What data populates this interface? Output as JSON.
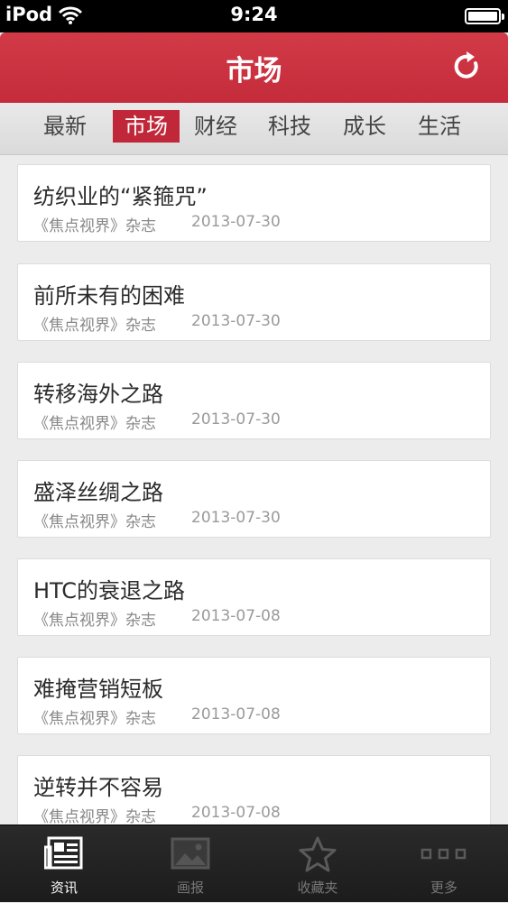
{
  "status_bar": {
    "carrier": "iPod",
    "time": "9:24"
  },
  "header": {
    "title": "市场",
    "refresh_icon": "refresh-icon"
  },
  "tabs": [
    {
      "label": "最新",
      "active": false
    },
    {
      "label": "市场",
      "active": true
    },
    {
      "label": "财经",
      "active": false
    },
    {
      "label": "科技",
      "active": false
    },
    {
      "label": "成长",
      "active": false
    },
    {
      "label": "生活",
      "active": false
    }
  ],
  "articles": [
    {
      "title": "纺织业的“紧箍咒”",
      "source": "《焦点视界》杂志",
      "date": "2013-07-30"
    },
    {
      "title": "前所未有的困难",
      "source": "《焦点视界》杂志",
      "date": "2013-07-30"
    },
    {
      "title": "转移海外之路",
      "source": "《焦点视界》杂志",
      "date": "2013-07-30"
    },
    {
      "title": "盛泽丝绸之路",
      "source": "《焦点视界》杂志",
      "date": "2013-07-30"
    },
    {
      "title": "HTC的衰退之路",
      "source": "《焦点视界》杂志",
      "date": "2013-07-08"
    },
    {
      "title": "难掩营销短板",
      "source": "《焦点视界》杂志",
      "date": "2013-07-08"
    },
    {
      "title": "逆转并不容易",
      "source": "《焦点视界》杂志",
      "date": "2013-07-08"
    }
  ],
  "bottom_nav": [
    {
      "label": "资讯",
      "icon": "newspaper-icon",
      "active": true
    },
    {
      "label": "画报",
      "icon": "picture-icon",
      "active": false
    },
    {
      "label": "收藏夹",
      "icon": "star-icon",
      "active": false
    },
    {
      "label": "更多",
      "icon": "more-dots-icon",
      "active": false
    }
  ],
  "colors": {
    "accent": "#c52c3b",
    "tab_active": "#c0283a",
    "bottom_bar": "#1f1f1f"
  }
}
